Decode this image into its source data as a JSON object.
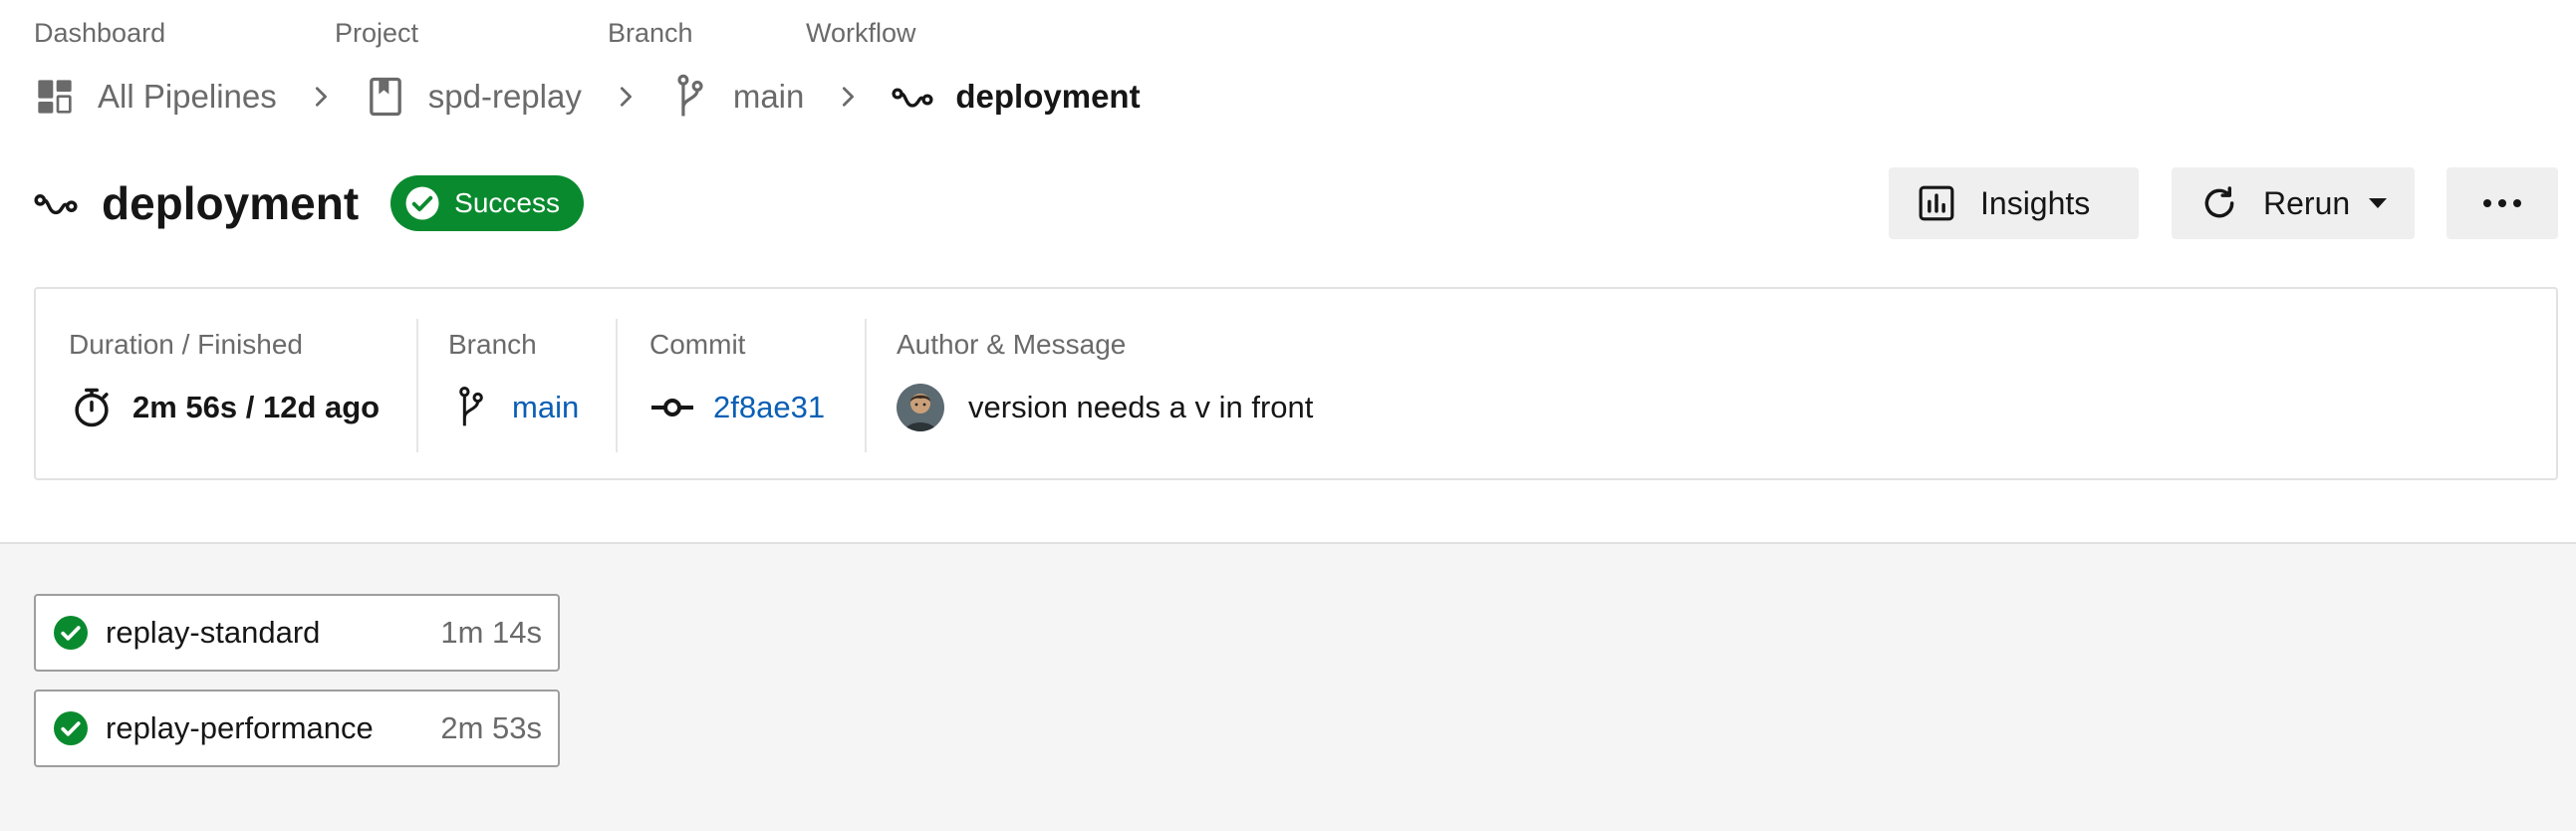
{
  "breadcrumb": {
    "labels": {
      "dashboard": "Dashboard",
      "project": "Project",
      "branch": "Branch",
      "workflow": "Workflow"
    },
    "items": {
      "dashboard": "All Pipelines",
      "project": "spd-replay",
      "branch": "main",
      "workflow": "deployment"
    }
  },
  "header": {
    "title": "deployment",
    "status": "Success",
    "insights_label": "Insights",
    "rerun_label": "Rerun"
  },
  "summary": {
    "duration_label": "Duration / Finished",
    "duration_value": "2m 56s / 12d ago",
    "branch_label": "Branch",
    "branch_value": "main",
    "commit_label": "Commit",
    "commit_value": "2f8ae31",
    "author_label": "Author & Message",
    "message": "version needs a v in front"
  },
  "jobs": [
    {
      "name": "replay-standard",
      "duration": "1m 14s",
      "status": "success"
    },
    {
      "name": "replay-performance",
      "duration": "2m 53s",
      "status": "success"
    }
  ],
  "colors": {
    "success": "#0a8a2e",
    "link": "#0a5fb4",
    "muted_text": "#6a6a6a",
    "button_bg": "#efefef"
  },
  "icons": {
    "dashboard": "dashboard-icon",
    "project": "bookmark-icon",
    "branch": "git-branch-icon",
    "workflow": "workflow-icon",
    "success": "check-circle-icon",
    "insights": "bar-chart-icon",
    "rerun": "refresh-icon",
    "more": "more-horizontal-icon",
    "timer": "stopwatch-icon",
    "commit": "git-commit-icon"
  }
}
